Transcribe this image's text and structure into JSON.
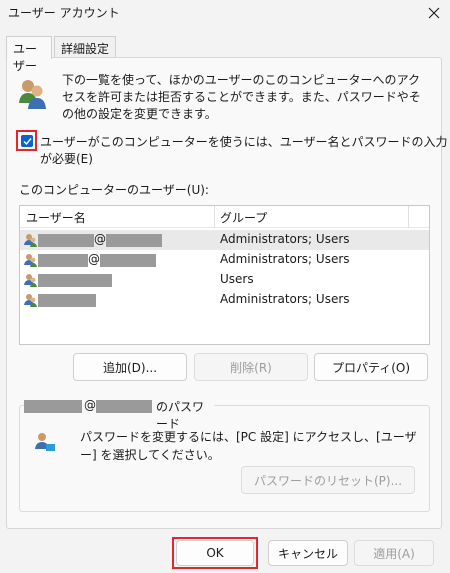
{
  "window": {
    "title": "ユーザー アカウント"
  },
  "tabs": [
    {
      "label": "ユーザー",
      "active": true
    },
    {
      "label": "詳細設定",
      "active": false
    }
  ],
  "description": "下の一覧を使って、ほかのユーザーのこのコンピューターへのアクセスを許可または拒否することができます。また、パスワードやその他の設定を変更できます。",
  "require_login": {
    "label": "ユーザーがこのコンピューターを使うには、ユーザー名とパスワードの入力が必要(E)",
    "checked": true
  },
  "user_list": {
    "label": "このコンピューターのユーザー(U):",
    "columns": [
      "ユーザー名",
      "グループ"
    ],
    "rows": [
      {
        "at": "@",
        "group": "Administrators; Users",
        "selected": true
      },
      {
        "at": "@",
        "group": "Administrators; Users",
        "selected": false
      },
      {
        "at": "",
        "group": "Users",
        "selected": false
      },
      {
        "at": "",
        "group": "Administrators; Users",
        "selected": false
      }
    ]
  },
  "list_buttons": {
    "add": "追加(D)...",
    "remove": "削除(R)",
    "properties": "プロパティ(O)"
  },
  "password_group": {
    "at": "@",
    "title_suffix": "のパスワード",
    "text": "パスワードを変更するには、[PC 設定] にアクセスし、[ユーザー] を選択してください。",
    "reset_button": "パスワードのリセット(P)..."
  },
  "dialog_buttons": {
    "ok": "OK",
    "cancel": "キャンセル",
    "apply": "適用(A)"
  },
  "colors": {
    "accent": "#0f62c6",
    "highlight": "#e0262e",
    "redaction": "#9a9a9a"
  }
}
